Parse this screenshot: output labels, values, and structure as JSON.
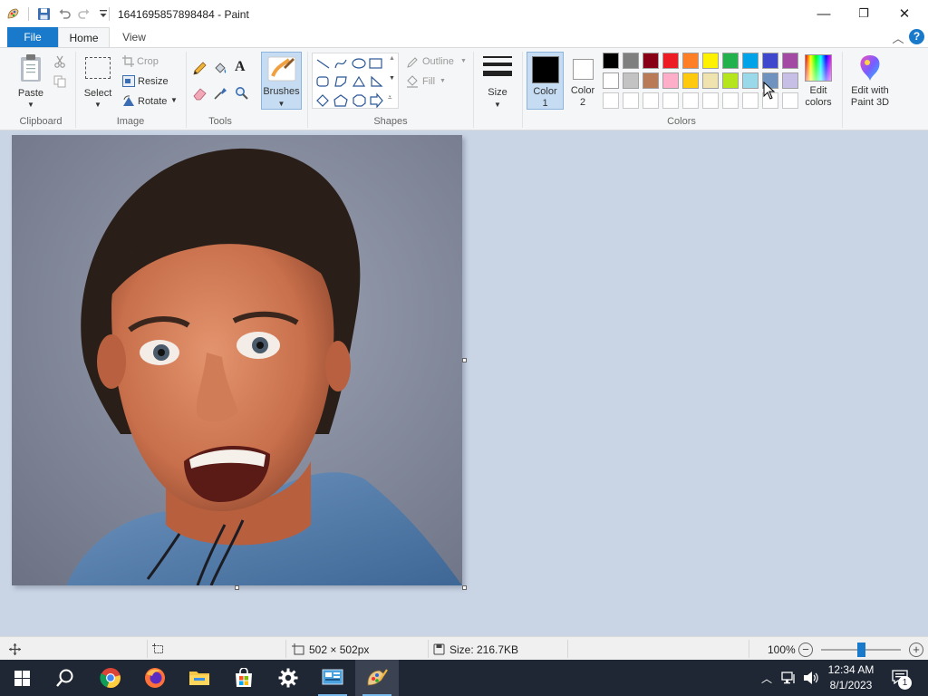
{
  "window": {
    "title": "1641695857898484 - Paint",
    "controls": {
      "minimize": "—",
      "maximize": "❐",
      "close": "✕"
    }
  },
  "tabs": [
    {
      "label": "File",
      "selected": false
    },
    {
      "label": "Home",
      "selected": true
    },
    {
      "label": "View",
      "selected": false
    }
  ],
  "ribbon": {
    "clipboard": {
      "group_label": "Clipboard",
      "paste_label": "Paste"
    },
    "image": {
      "group_label": "Image",
      "select_label": "Select",
      "crop_label": "Crop",
      "resize_label": "Resize",
      "rotate_label": "Rotate"
    },
    "tools": {
      "group_label": "Tools"
    },
    "brushes": {
      "label": "Brushes"
    },
    "shapes": {
      "group_label": "Shapes",
      "outline_label": "Outline",
      "fill_label": "Fill"
    },
    "size": {
      "label": "Size"
    },
    "color1": {
      "label_line1": "Color",
      "label_line2": "1",
      "value": "#000000"
    },
    "color2": {
      "label_line1": "Color",
      "label_line2": "2",
      "value": "#ffffff"
    },
    "colors": {
      "group_label": "Colors",
      "row1": [
        "#000000",
        "#7f7f7f",
        "#880015",
        "#ed1c24",
        "#ff7f27",
        "#fff200",
        "#22b14c",
        "#00a2e8",
        "#3f48cc",
        "#a349a4"
      ],
      "row2": [
        "#ffffff",
        "#c3c3c3",
        "#b97a57",
        "#ffaec9",
        "#ffc90e",
        "#efe4b0",
        "#b5e61d",
        "#99d9ea",
        "#7092be",
        "#c8bfe7"
      ],
      "row3_empty_count": 10,
      "edit_colors_line1": "Edit",
      "edit_colors_line2": "colors"
    },
    "paint3d": {
      "line1": "Edit with",
      "line2": "Paint 3D"
    }
  },
  "statusbar": {
    "dimensions": "502 × 502px",
    "size": "Size: 216.7KB",
    "zoom": "100%",
    "zoom_level_fraction": 0.5
  },
  "taskbar": {
    "apps": [
      "start",
      "search",
      "chrome",
      "firefox",
      "file-explorer",
      "microsoft-store",
      "settings",
      "control-panel",
      "paint"
    ],
    "time": "12:34 AM",
    "date": "8/1/2023",
    "notification_count": "1"
  },
  "icons": {
    "help": "?",
    "collapse_ribbon": "︿"
  }
}
